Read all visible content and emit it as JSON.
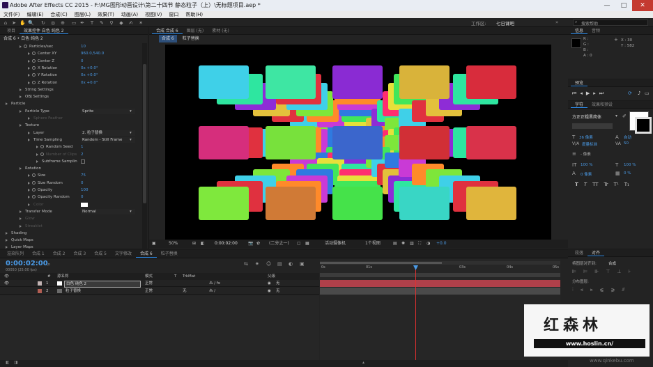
{
  "window": {
    "title": "Adobe After Effects CC 2015 - F:\\MG图形动画设计\\第二十四节 静态粒子（上）\\无标题项目.aep *",
    "min": "—",
    "max": "□",
    "close": "✕"
  },
  "menu": [
    "文件(F)",
    "编辑(E)",
    "合成(C)",
    "图层(L)",
    "效果(T)",
    "动画(A)",
    "视图(V)",
    "窗口",
    "帮助(H)"
  ],
  "toolbar": {
    "workspace_label": "工作区:",
    "workspace_value": "七日课吧",
    "search_placeholder": "搜索帮助"
  },
  "left_panel": {
    "tabs": [
      "项目",
      "效果控件 白色 纯色 2"
    ],
    "breadcrumb": "合成 6 • 白色 纯色 2",
    "rows": [
      {
        "label": "Particles/sec",
        "value": "10",
        "indent": 36
      },
      {
        "label": "Center XY",
        "value": "960.0,540.0",
        "indent": 48
      },
      {
        "label": "Center Z",
        "value": "0",
        "indent": 48
      },
      {
        "label": "X Rotation",
        "value": "0x +0.0°",
        "indent": 48
      },
      {
        "label": "Y Rotation",
        "value": "0x +0.0°",
        "indent": 48
      },
      {
        "label": "Z Rotation",
        "value": "0x +0.0°",
        "indent": 48
      },
      {
        "label": "String Settings",
        "value": "",
        "indent": 36
      },
      {
        "label": "OBJ Settings",
        "value": "",
        "indent": 36
      },
      {
        "label": "Particle",
        "value": "",
        "indent": 16
      },
      {
        "label": "Particle Type",
        "value": "Sprite",
        "indent": 36,
        "dd": true
      },
      {
        "label": "Sphere Feather",
        "value": "",
        "indent": 48,
        "dim": true
      },
      {
        "label": "Texture",
        "value": "",
        "indent": 36
      },
      {
        "label": "Layer",
        "value": "2. 粒子替换",
        "indent": 48,
        "dd": true
      },
      {
        "label": "Time Sampling",
        "value": "Random - Still Frame",
        "indent": 48,
        "dd": true
      },
      {
        "label": "Random Seed",
        "value": "1",
        "indent": 60
      },
      {
        "label": "Number of Clips",
        "value": "2",
        "indent": 60,
        "dim": true
      },
      {
        "label": "Subframe Samplin",
        "value": "",
        "indent": 60
      },
      {
        "label": "Rotation",
        "value": "",
        "indent": 36
      },
      {
        "label": "Size",
        "value": "75",
        "indent": 48
      },
      {
        "label": "Size Random",
        "value": "0",
        "indent": 48
      },
      {
        "label": "Opacity",
        "value": "100",
        "indent": 48
      },
      {
        "label": "Opacity Random",
        "value": "0",
        "indent": 48
      },
      {
        "label": "Color",
        "value": "",
        "indent": 48,
        "dim": true
      },
      {
        "label": "Transfer Mode",
        "value": "Normal",
        "indent": 36,
        "dd": true
      },
      {
        "label": "Glow",
        "value": "",
        "indent": 36,
        "dim": true
      },
      {
        "label": "Streaklet",
        "value": "",
        "indent": 36,
        "dim": true
      },
      {
        "label": "Shading",
        "value": "",
        "indent": 16
      },
      {
        "label": "Quick Maps",
        "value": "",
        "indent": 16
      },
      {
        "label": "Layer Maps",
        "value": "",
        "indent": 16
      }
    ]
  },
  "viewer": {
    "tabs": [
      "合成 合成 6",
      "图层 (无)",
      "素材 (无)"
    ],
    "breadcrumbs": [
      "合成 6",
      "粒子替换"
    ],
    "footer": {
      "zoom": "50%",
      "timecode": "0:00:02:00",
      "resolution": "(二分之一)",
      "camera": "活动摄像机",
      "views": "1个视图",
      "offset": "+0.0"
    }
  },
  "timeline": {
    "tabs": [
      "渲染队列",
      "合成 1",
      "合成 2",
      "合成 3",
      "合成 5",
      "文字修改",
      "合成 6",
      "粒子替换"
    ],
    "timecode": "0:00:02:00",
    "fps": "00050 (25.00 fps)",
    "ruler": [
      "0s",
      "01s",
      "03s",
      "04s",
      "05s"
    ],
    "columns": {
      "num": "#",
      "name": "源名称",
      "mode": "模式",
      "t": "T",
      "trkmat": "TrkMat",
      "parent": "父级"
    },
    "layers": [
      {
        "num": "1",
        "name": "白色 纯色 2",
        "mode": "正常",
        "trkmat": "",
        "parent": "无",
        "color": "#c2b3b3"
      },
      {
        "num": "2",
        "name": "粒子替换",
        "mode": "正常",
        "trkmat": "无",
        "parent": "无",
        "color": "#b25e53"
      }
    ]
  },
  "right_panel": {
    "info_tabs": [
      "信息",
      "音频"
    ],
    "info": {
      "r": "R :",
      "g": "G :",
      "b": "B :",
      "a": "A : 0",
      "x": "X : 30",
      "y": "Y : 582"
    },
    "preview_tab": "预览",
    "char_tabs": [
      "字符",
      "效果和预设"
    ],
    "font_name": "方正正粗黑简体",
    "font_size": "36 像素",
    "leading": "自动",
    "kerning": "度量标准",
    "tracking": "50",
    "stroke": "- 像素",
    "vscale": "100 %",
    "hscale": "100 %",
    "baseline": "0 像素",
    "tsume": "0 %",
    "typo_buttons": [
      "T",
      "T",
      "TT",
      "Tr",
      "T¹",
      "T₁"
    ],
    "align_tabs": [
      "段落",
      "对齐"
    ],
    "align_to_label": "将图层对齐到:",
    "align_to_value": "合成",
    "distribute_label": "分布图层:"
  },
  "watermark": {
    "brand": "红森林",
    "url": "www.hoslin.cn/",
    "site": "www.qinkebu.com"
  }
}
